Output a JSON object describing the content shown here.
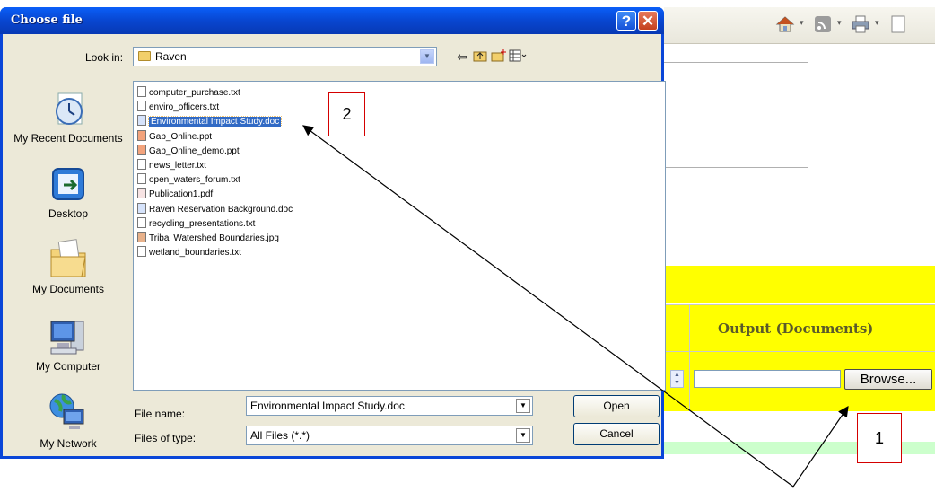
{
  "dialog": {
    "title": "Choose file",
    "help_glyph": "?",
    "close_glyph": "✕",
    "look_in_label": "Look in:",
    "look_in_value": "Raven",
    "places": [
      {
        "label": "My Recent Documents",
        "icon": "recent-documents-icon"
      },
      {
        "label": "Desktop",
        "icon": "desktop-icon"
      },
      {
        "label": "My Documents",
        "icon": "my-documents-icon"
      },
      {
        "label": "My Computer",
        "icon": "my-computer-icon"
      },
      {
        "label": "My Network",
        "icon": "my-network-icon"
      }
    ],
    "files": [
      {
        "name": "computer_purchase.txt",
        "type": "txt"
      },
      {
        "name": "enviro_officers.txt",
        "type": "txt"
      },
      {
        "name": "Environmental Impact Study.doc",
        "type": "doc",
        "selected": true
      },
      {
        "name": "Gap_Online.ppt",
        "type": "ppt"
      },
      {
        "name": "Gap_Online_demo.ppt",
        "type": "ppt"
      },
      {
        "name": "news_letter.txt",
        "type": "txt"
      },
      {
        "name": "open_waters_forum.txt",
        "type": "txt"
      },
      {
        "name": "Publication1.pdf",
        "type": "pdf"
      },
      {
        "name": "Raven Reservation Background.doc",
        "type": "doc"
      },
      {
        "name": "recycling_presentations.txt",
        "type": "txt"
      },
      {
        "name": "Tribal Watershed Boundaries.jpg",
        "type": "jpg"
      },
      {
        "name": "wetland_boundaries.txt",
        "type": "txt"
      }
    ],
    "file_name_label": "File name:",
    "file_name_value": "Environmental Impact Study.doc",
    "file_type_label": "Files of type:",
    "file_type_value": "All Files (*.*)",
    "open_label": "Open",
    "cancel_label": "Cancel"
  },
  "page": {
    "output_header": "Output (Documents)",
    "browse_label": "Browse...",
    "colors": {
      "yellow": "#ffff00",
      "green": "#ccffcc"
    }
  },
  "annotations": {
    "callout_1": "1",
    "callout_2": "2",
    "color": "#d40000"
  }
}
